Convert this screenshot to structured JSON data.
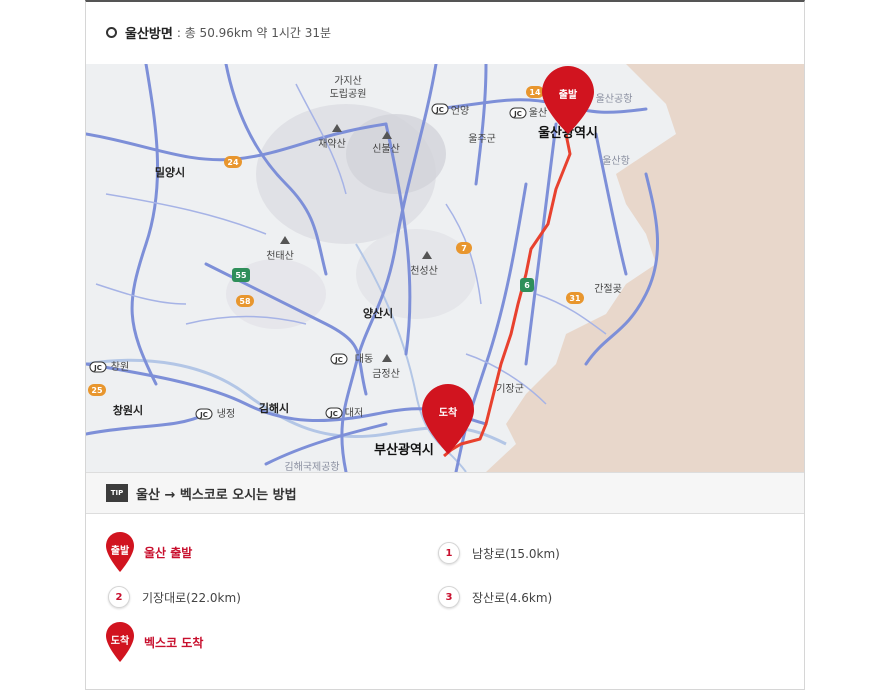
{
  "header": {
    "title": "울산방면",
    "summary": ": 총 50.96km 약 1시간 31분"
  },
  "map": {
    "colors": {
      "land": "#eef0f2",
      "sea": "#e9d8cc",
      "route": "#e8412e",
      "road": "#7d8fd8",
      "pin": "#d1141f"
    },
    "labels": {
      "gajisan": "가지산",
      "park": "도립공원",
      "jaeyaksan": "재약산",
      "sinbulsan": "신불산",
      "eonyang": "언양",
      "ulsan_jc": "울산",
      "uljugun": "울주군",
      "ulsan_city": "울산광역시",
      "ulsan_airport": "울산공항",
      "ulsan_port": "울산항",
      "miryang": "밀양시",
      "cheontaesan": "천태산",
      "cheonseongsan": "천성산",
      "ganjeolgot": "간절곶",
      "yangsan": "양산시",
      "daedong": "대동",
      "geumjeongsan": "금정산",
      "gijang": "기장군",
      "changwon_jc": "창원",
      "changwon_city": "창원시",
      "naengjeong": "냉정",
      "gimhae": "김해시",
      "daejeo": "대저",
      "busan_city": "부산광역시",
      "gimhae_airport": "김해국제공항",
      "jc": "JC",
      "r24": "24",
      "r55": "55",
      "r58": "58",
      "r25": "25",
      "r14": "14",
      "r7": "7",
      "r31": "31",
      "r6": "6"
    },
    "start_pin": "출발",
    "end_pin": "도착"
  },
  "tip": {
    "badge": "TIP",
    "title": "울산 → 벡스코로 오시는 방법"
  },
  "route": {
    "start_pin": "출발",
    "start_label": "울산 출발",
    "steps": [
      {
        "num": "1",
        "label": "남창로(15.0km)"
      },
      {
        "num": "2",
        "label": "기장대로(22.0km)"
      },
      {
        "num": "3",
        "label": "장산로(4.6km)"
      }
    ],
    "end_pin": "도착",
    "end_label": "벡스코 도착"
  }
}
